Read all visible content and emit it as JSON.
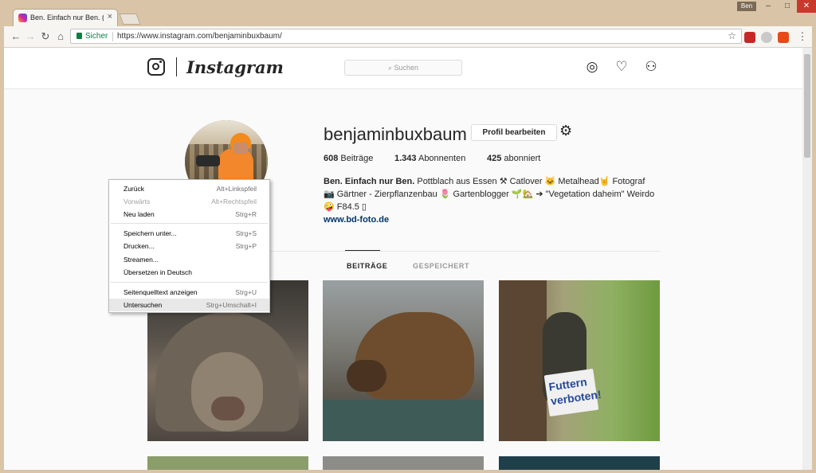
{
  "browser": {
    "tab_title": "Ben. Einfach nur Ben. (@",
    "tab_close": "×",
    "user_badge": "Ben",
    "win_min": "–",
    "win_max": "□",
    "win_close": "✕",
    "secure_label": "Sicher",
    "url": "https://www.instagram.com/benjaminbuxbaum/"
  },
  "header": {
    "wordmark": "Instagram",
    "search_placeholder": "Suchen"
  },
  "profile": {
    "username": "benjaminbuxbaum",
    "edit_label": "Profil bearbeiten",
    "stats": [
      {
        "value": "608",
        "label": " Beiträge"
      },
      {
        "value": "1.343",
        "label": " Abonnenten"
      },
      {
        "value": "425",
        "label": " abonniert"
      }
    ],
    "bio_name": "Ben. Einfach nur Ben.",
    "bio_text": " Pottblach aus Essen ⚒ Catlover 🐱 Metalhead🤘 Fotograf 📷 Gärtner - Zierpflanzenbau 🌷 Gartenblogger 🌱🏡 ➔ \"Vegetation daheim\" Weirdo 🤪 F84.5 ▯",
    "link": "www.bd-foto.de"
  },
  "tabs": {
    "posts": "BEITRÄGE",
    "saved": "GESPEICHERT"
  },
  "posts": {
    "sign_text": "Futtern\nverboten!"
  },
  "context_menu": {
    "items": [
      {
        "label": "Zurück",
        "shortcut": "Alt+Linkspfeil",
        "disabled": false
      },
      {
        "label": "Vorwärts",
        "shortcut": "Alt+Rechtspfeil",
        "disabled": true
      },
      {
        "label": "Neu laden",
        "shortcut": "Strg+R",
        "disabled": false
      },
      {
        "label": "Speichern unter...",
        "shortcut": "Strg+S",
        "disabled": false
      },
      {
        "label": "Drucken...",
        "shortcut": "Strg+P",
        "disabled": false
      },
      {
        "label": "Streamen...",
        "shortcut": "",
        "disabled": false
      },
      {
        "label": "Übersetzen in Deutsch",
        "shortcut": "",
        "disabled": false
      },
      {
        "label": "Seitenquelltext anzeigen",
        "shortcut": "Strg+U",
        "disabled": false
      },
      {
        "label": "Untersuchen",
        "shortcut": "Strg+Umschalt+I",
        "disabled": false
      }
    ]
  }
}
